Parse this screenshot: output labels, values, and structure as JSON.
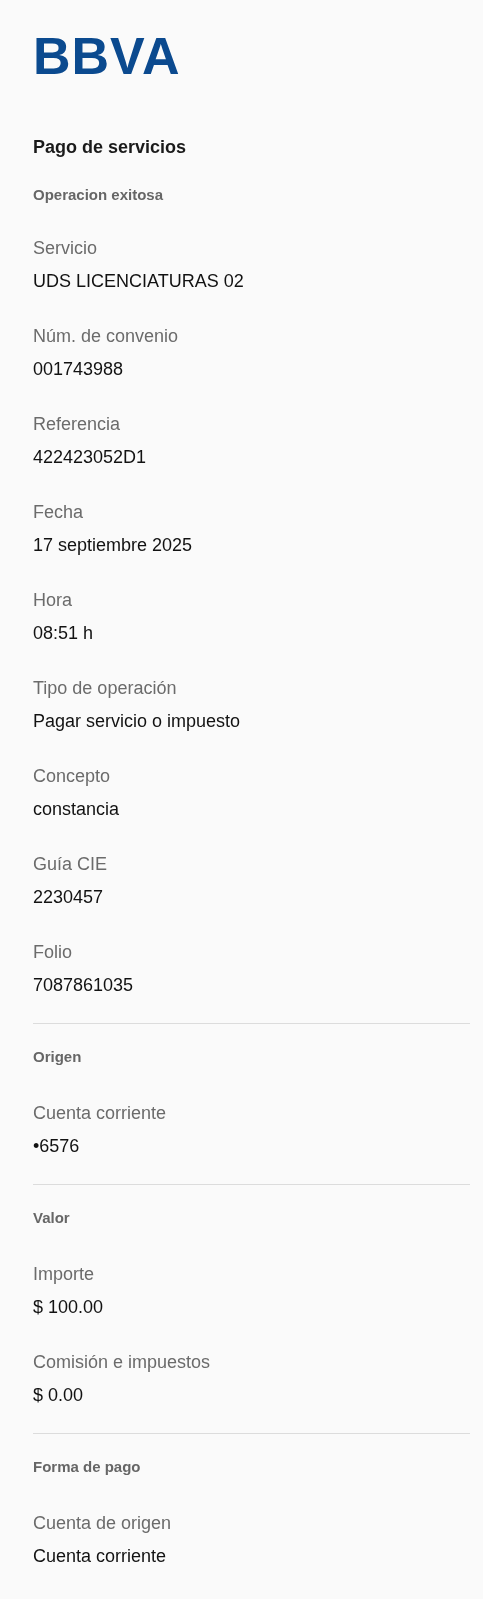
{
  "logo": "BBVA",
  "title": "Pago de servicios",
  "sections": [
    {
      "heading": "Operacion exitosa",
      "fields": [
        {
          "label": "Servicio",
          "value": "UDS LICENCIATURAS 02"
        },
        {
          "label": "Núm. de convenio",
          "value": "001743988"
        },
        {
          "label": "Referencia",
          "value": "422423052D1"
        },
        {
          "label": "Fecha",
          "value": "17 septiembre 2025"
        },
        {
          "label": "Hora",
          "value": "08:51 h"
        },
        {
          "label": "Tipo de operación",
          "value": "Pagar servicio o impuesto"
        },
        {
          "label": "Concepto",
          "value": "constancia"
        },
        {
          "label": "Guía CIE",
          "value": "2230457"
        },
        {
          "label": "Folio",
          "value": "7087861035"
        }
      ]
    },
    {
      "heading": "Origen",
      "fields": [
        {
          "label": "Cuenta corriente",
          "value": "•6576"
        }
      ]
    },
    {
      "heading": "Valor",
      "fields": [
        {
          "label": "Importe",
          "value": "$ 100.00"
        },
        {
          "label": "Comisión e impuestos",
          "value": "$ 0.00"
        }
      ]
    },
    {
      "heading": "Forma de pago",
      "fields": [
        {
          "label": "Cuenta de origen",
          "value": "Cuenta corriente"
        }
      ]
    }
  ]
}
